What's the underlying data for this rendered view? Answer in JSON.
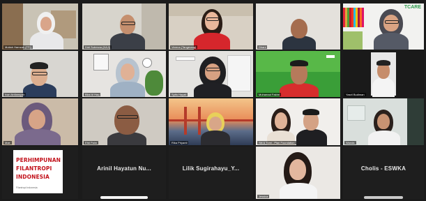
{
  "tiles": [
    {
      "name": "Mutiah Hamzah (FFI)"
    },
    {
      "name": "Didi Sutresna (KAJI)"
    },
    {
      "name": "Verena (Tangerang)"
    },
    {
      "name": "Dhani"
    },
    {
      "name": ""
    },
    {
      "name": "Ivan Ardiansyah"
    },
    {
      "name": "Bilal Al Haq"
    },
    {
      "name": "Syifa Hayati"
    },
    {
      "name": "Muhamad Fakhri"
    },
    {
      "name": "Yasril Budiman"
    },
    {
      "name": "Mae"
    },
    {
      "name": "Efdi Palm"
    },
    {
      "name": "Rika Priyanti"
    },
    {
      "name": "Siti & Tomi - Plan Foundation"
    },
    {
      "name": "Wanda"
    },
    {
      "name": "Arinil Hayatun Nu..."
    },
    {
      "name": "Lilik Sugirahayu_Y..."
    },
    {
      "name": "Jessica"
    },
    {
      "name": "Cholis - ESWKA"
    }
  ],
  "logo": {
    "lines": [
      "PERHIMPUNAN",
      "FILANTROPI",
      "INDONESIA"
    ],
    "footer": "Filantropi Indonesia",
    "brand_color": "#c2121b"
  },
  "banner": {
    "text": "TCARE"
  }
}
